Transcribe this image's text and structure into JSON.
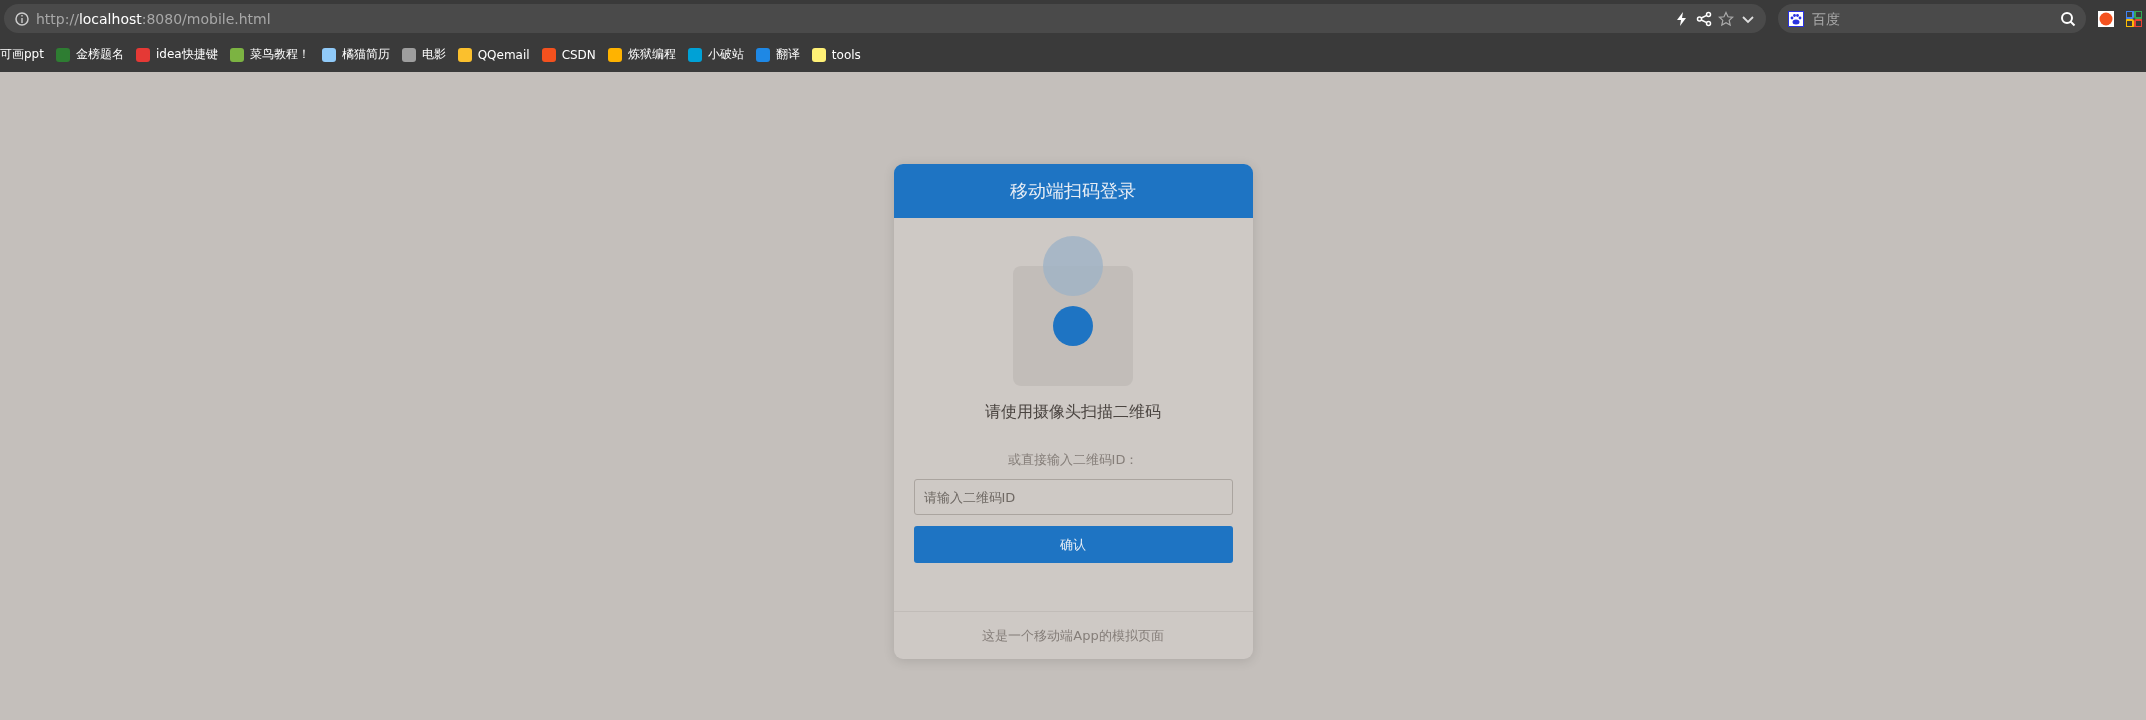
{
  "browser": {
    "address": {
      "scheme": "http://",
      "host": "localhost",
      "rest": ":8080/mobile.html"
    },
    "search": {
      "placeholder": "百度"
    },
    "bookmarks": [
      {
        "label": "可画ppt"
      },
      {
        "label": "金榜题名",
        "color": "#2e7d32"
      },
      {
        "label": "idea快捷键",
        "color": "#e53935"
      },
      {
        "label": "菜鸟教程！",
        "color": "#7cb342"
      },
      {
        "label": "橘猫简历",
        "color": "#90caf9"
      },
      {
        "label": "电影",
        "color": "#9e9e9e"
      },
      {
        "label": "QQemail",
        "color": "#fbc02d"
      },
      {
        "label": "CSDN",
        "color": "#f4511e"
      },
      {
        "label": "炼狱编程",
        "color": "#ffb300"
      },
      {
        "label": "小破站",
        "color": "#00a1d6"
      },
      {
        "label": "翻译",
        "color": "#1e88e5"
      },
      {
        "label": "tools",
        "color": "#fff176"
      }
    ]
  },
  "card": {
    "title": "移动端扫码登录",
    "scan_hint": "请使用摄像头扫描二维码",
    "manual_label": "或直接输入二维码ID：",
    "input": {
      "placeholder": "请输入二维码ID"
    },
    "confirm_button": "确认",
    "footer": "这是一个移动端App的模拟页面"
  }
}
